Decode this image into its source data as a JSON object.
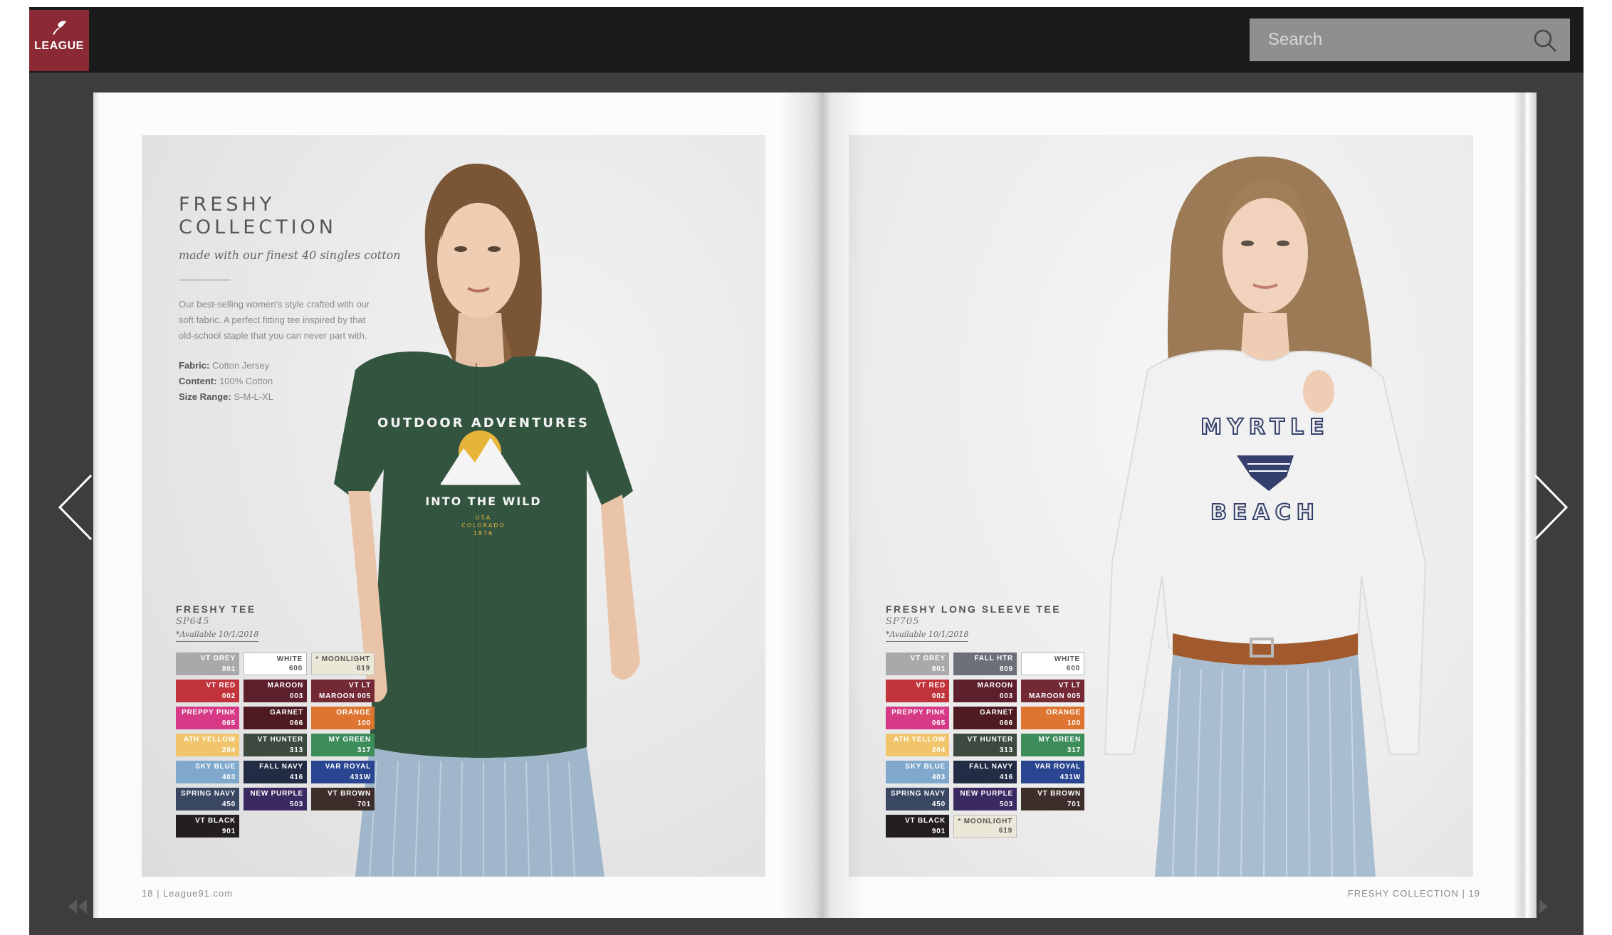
{
  "header": {
    "logo_text": "LEAGUE",
    "search_placeholder": "Search"
  },
  "colors": {
    "brand": "#8b2a35",
    "topbar": "#1b1b1c",
    "frame": "#3d3d3f"
  },
  "icons": [
    "league-logo-icon",
    "search-icon",
    "prev-page-icon",
    "next-page-icon",
    "first-page-icon",
    "last-page-icon"
  ],
  "left_page": {
    "title_line1": "FRESHY",
    "title_line2": "COLLECTION",
    "tagline": "made with our finest 40 singles cotton",
    "description_lines": [
      "Our best-selling women's style crafted with our",
      "soft fabric. A perfect fitting tee inspired by that",
      "old-school staple that you can never part with."
    ],
    "fabric_label": "Fabric:",
    "fabric_value": "Cotton Jersey",
    "content_label": "Content:",
    "content_value": "100% Cotton",
    "size_label": "Size Range:",
    "size_value": "S-M-L-XL",
    "product_name": "FRESHY TEE",
    "sku": "SP645",
    "availability": "*Available 10/1/2018",
    "footer": "18  |  League91.com",
    "shirt_text_top": "OUTDOOR ADVENTURES",
    "shirt_text_mid": "INTO THE WILD",
    "shirt_text_small1": "USA",
    "shirt_text_small2": "COLORADO",
    "shirt_text_small3": "1876",
    "swatches": [
      {
        "name": "VT GREY",
        "code": "801",
        "color": "#a9a9a9",
        "light": false
      },
      {
        "name": "WHITE",
        "code": "600",
        "color": "#ffffff",
        "light": true
      },
      {
        "name": "* MOONLIGHT",
        "code": "619",
        "color": "#ece8d8",
        "light": true
      },
      {
        "name": "VT RED",
        "code": "002",
        "color": "#c2343b",
        "light": false
      },
      {
        "name": "MAROON",
        "code": "003",
        "color": "#5d1f2c",
        "light": false
      },
      {
        "name": "VT LT",
        "code": "MAROON 005",
        "color": "#742a35",
        "light": false
      },
      {
        "name": "PREPPY PINK",
        "code": "065",
        "color": "#d63a86",
        "light": false
      },
      {
        "name": "GARNET",
        "code": "066",
        "color": "#4d1b21",
        "light": false
      },
      {
        "name": "ORANGE",
        "code": "100",
        "color": "#dd7430",
        "light": false
      },
      {
        "name": "ATH YELLOW",
        "code": "204",
        "color": "#f0c56c",
        "light": false
      },
      {
        "name": "VT HUNTER",
        "code": "313",
        "color": "#3c4a40",
        "light": false
      },
      {
        "name": "MY GREEN",
        "code": "317",
        "color": "#3d8d5b",
        "light": false
      },
      {
        "name": "SKY BLUE",
        "code": "403",
        "color": "#7fa8cc",
        "light": false
      },
      {
        "name": "FALL NAVY",
        "code": "416",
        "color": "#232c45",
        "light": false
      },
      {
        "name": "VAR ROYAL",
        "code": "431W",
        "color": "#2a4690",
        "light": false
      },
      {
        "name": "SPRING NAVY",
        "code": "450",
        "color": "#3a4763",
        "light": false
      },
      {
        "name": "NEW PURPLE",
        "code": "503",
        "color": "#3b2a62",
        "light": false
      },
      {
        "name": "VT BROWN",
        "code": "701",
        "color": "#3d2e2b",
        "light": false
      },
      {
        "name": "VT BLACK",
        "code": "901",
        "color": "#231f20",
        "light": false
      }
    ]
  },
  "right_page": {
    "product_name": "FRESHY LONG SLEEVE TEE",
    "sku": "SP705",
    "availability": "*Available 10/1/2018",
    "footer": "FRESHY COLLECTION  |  19",
    "shirt_text_top": "MYRTLE",
    "shirt_text_bottom": "BEACH",
    "swatches": [
      {
        "name": "VT GREY",
        "code": "801",
        "color": "#a9a9a9",
        "light": false
      },
      {
        "name": "FALL HTR",
        "code": "809",
        "color": "#6d6f78",
        "light": false
      },
      {
        "name": "WHITE",
        "code": "600",
        "color": "#ffffff",
        "light": true
      },
      {
        "name": "VT RED",
        "code": "002",
        "color": "#c2343b",
        "light": false
      },
      {
        "name": "MAROON",
        "code": "003",
        "color": "#5d1f2c",
        "light": false
      },
      {
        "name": "VT LT",
        "code": "MAROON 005",
        "color": "#742a35",
        "light": false
      },
      {
        "name": "PREPPY PINK",
        "code": "065",
        "color": "#d63a86",
        "light": false
      },
      {
        "name": "GARNET",
        "code": "066",
        "color": "#4d1b21",
        "light": false
      },
      {
        "name": "ORANGE",
        "code": "100",
        "color": "#dd7430",
        "light": false
      },
      {
        "name": "ATH YELLOW",
        "code": "204",
        "color": "#f0c56c",
        "light": false
      },
      {
        "name": "VT HUNTER",
        "code": "313",
        "color": "#3c4a40",
        "light": false
      },
      {
        "name": "MY GREEN",
        "code": "317",
        "color": "#3d8d5b",
        "light": false
      },
      {
        "name": "SKY BLUE",
        "code": "403",
        "color": "#7fa8cc",
        "light": false
      },
      {
        "name": "FALL NAVY",
        "code": "416",
        "color": "#232c45",
        "light": false
      },
      {
        "name": "VAR ROYAL",
        "code": "431W",
        "color": "#2a4690",
        "light": false
      },
      {
        "name": "SPRING NAVY",
        "code": "450",
        "color": "#3a4763",
        "light": false
      },
      {
        "name": "NEW PURPLE",
        "code": "503",
        "color": "#3b2a62",
        "light": false
      },
      {
        "name": "VT BROWN",
        "code": "701",
        "color": "#3d2e2b",
        "light": false
      },
      {
        "name": "VT BLACK",
        "code": "901",
        "color": "#231f20",
        "light": false
      },
      {
        "name": "* MOONLIGHT",
        "code": "619",
        "color": "#ece8d8",
        "light": true
      }
    ]
  }
}
